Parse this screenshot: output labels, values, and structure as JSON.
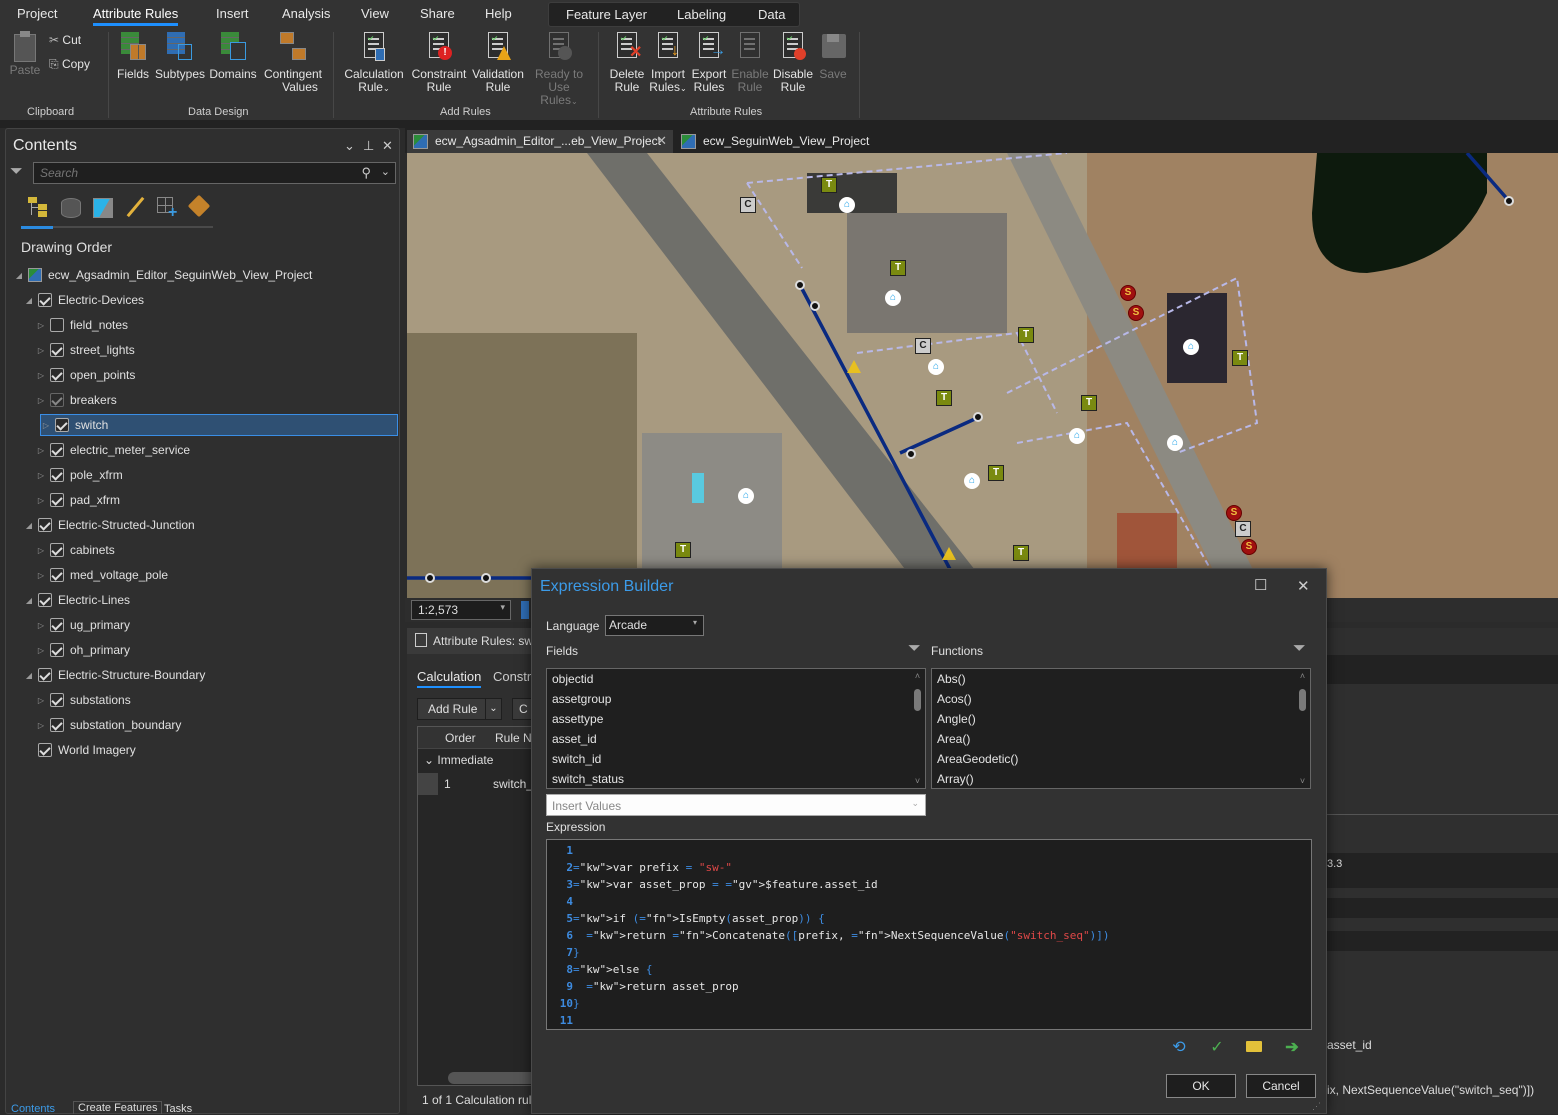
{
  "menu": {
    "items": [
      "Project",
      "Attribute Rules",
      "Insert",
      "Analysis",
      "View",
      "Share",
      "Help"
    ],
    "active": "Attribute Rules",
    "contextual_tabs": [
      "Feature Layer",
      "Labeling",
      "Data"
    ]
  },
  "ribbon": {
    "clipboard": {
      "label": "Clipboard",
      "paste": "Paste",
      "cut": "Cut",
      "copy": "Copy"
    },
    "data_design": {
      "label": "Data Design",
      "fields": "Fields",
      "subtypes": "Subtypes",
      "domains": "Domains",
      "contingent_1": "Contingent",
      "contingent_2": "Values"
    },
    "add_rules": {
      "label": "Add Rules",
      "calc_1": "Calculation",
      "calc_2": "Rule",
      "constraint_1": "Constraint",
      "constraint_2": "Rule",
      "validation_1": "Validation",
      "validation_2": "Rule",
      "ready_1": "Ready to",
      "ready_2": "Use Rules"
    },
    "attribute_rules": {
      "label": "Attribute Rules",
      "delete_1": "Delete",
      "delete_2": "Rule",
      "import_1": "Import",
      "import_2": "Rules",
      "export_1": "Export",
      "export_2": "Rules",
      "enable_1": "Enable",
      "enable_2": "Rule",
      "disable_1": "Disable",
      "disable_2": "Rule",
      "save": "Save"
    }
  },
  "contents": {
    "title": "Contents",
    "search_placeholder": "Search",
    "section": "Drawing Order",
    "map_name": "ecw_Agsadmin_Editor_SeguinWeb_View_Project",
    "groups": [
      {
        "name": "Electric-Devices",
        "checked": true,
        "layers": [
          {
            "name": "field_notes",
            "checked": false
          },
          {
            "name": "street_lights",
            "checked": true
          },
          {
            "name": "open_points",
            "checked": true
          },
          {
            "name": "breakers",
            "checked": true,
            "dimmed": true
          },
          {
            "name": "switch",
            "checked": true,
            "selected": true
          },
          {
            "name": "electric_meter_service",
            "checked": true
          },
          {
            "name": "pole_xfrm",
            "checked": true
          },
          {
            "name": "pad_xfrm",
            "checked": true
          }
        ]
      },
      {
        "name": "Electric-Structed-Junction",
        "checked": true,
        "layers": [
          {
            "name": "cabinets",
            "checked": true
          },
          {
            "name": "med_voltage_pole",
            "checked": true
          }
        ]
      },
      {
        "name": "Electric-Lines",
        "checked": true,
        "layers": [
          {
            "name": "ug_primary",
            "checked": true
          },
          {
            "name": "oh_primary",
            "checked": true
          }
        ]
      },
      {
        "name": "Electric-Structure-Boundary",
        "checked": true,
        "layers": [
          {
            "name": "substations",
            "checked": true
          },
          {
            "name": "substation_boundary",
            "checked": true
          }
        ]
      }
    ],
    "basemap": {
      "name": "World Imagery",
      "checked": true
    },
    "bottom_tabs": [
      "Contents",
      "Create Features",
      "Tasks"
    ]
  },
  "map": {
    "tabs": [
      {
        "label": "ecw_Agsadmin_Editor_...eb_View_Project",
        "active": true
      },
      {
        "label": "ecw_SeguinWeb_View_Project",
        "active": false
      }
    ],
    "scale": "1:2,573"
  },
  "attribute_rules_pane": {
    "title": "Attribute Rules: sw",
    "tabs": [
      "Calculation",
      "Constr"
    ],
    "add_rule": "Add Rule",
    "columns": [
      "Order",
      "Rule N"
    ],
    "group": "Immediate",
    "rows": [
      {
        "order": "1",
        "name": "switch_"
      }
    ],
    "status": "1 of 1 Calculation rul",
    "right_fragments": {
      "version": "3.3",
      "field": "asset_id",
      "expr": "ix, NextSequenceValue(\"switch_seq\")])"
    }
  },
  "expression_builder": {
    "title": "Expression Builder",
    "language_label": "Language",
    "language": "Arcade",
    "fields_label": "Fields",
    "functions_label": "Functions",
    "fields": [
      "objectid",
      "assetgroup",
      "assettype",
      "asset_id",
      "switch_id",
      "switch_status"
    ],
    "functions": [
      "Abs()",
      "Acos()",
      "Angle()",
      "Area()",
      "AreaGeodetic()",
      "Array()"
    ],
    "insert_values_placeholder": "Insert Values",
    "expression_label": "Expression",
    "code_lines": [
      "",
      "var prefix = \"sw-\"",
      "var asset_prop = $feature.asset_id",
      "",
      "if (IsEmpty(asset_prop)) {",
      "  return Concatenate([prefix, NextSequenceValue(\"switch_seq\")])",
      "}",
      "else {",
      "  return asset_prop",
      "}",
      ""
    ],
    "ok": "OK",
    "cancel": "Cancel"
  },
  "colors": {
    "accent": "#1e90ff",
    "selection": "#2f5073",
    "title_blue": "#3c9be8"
  }
}
